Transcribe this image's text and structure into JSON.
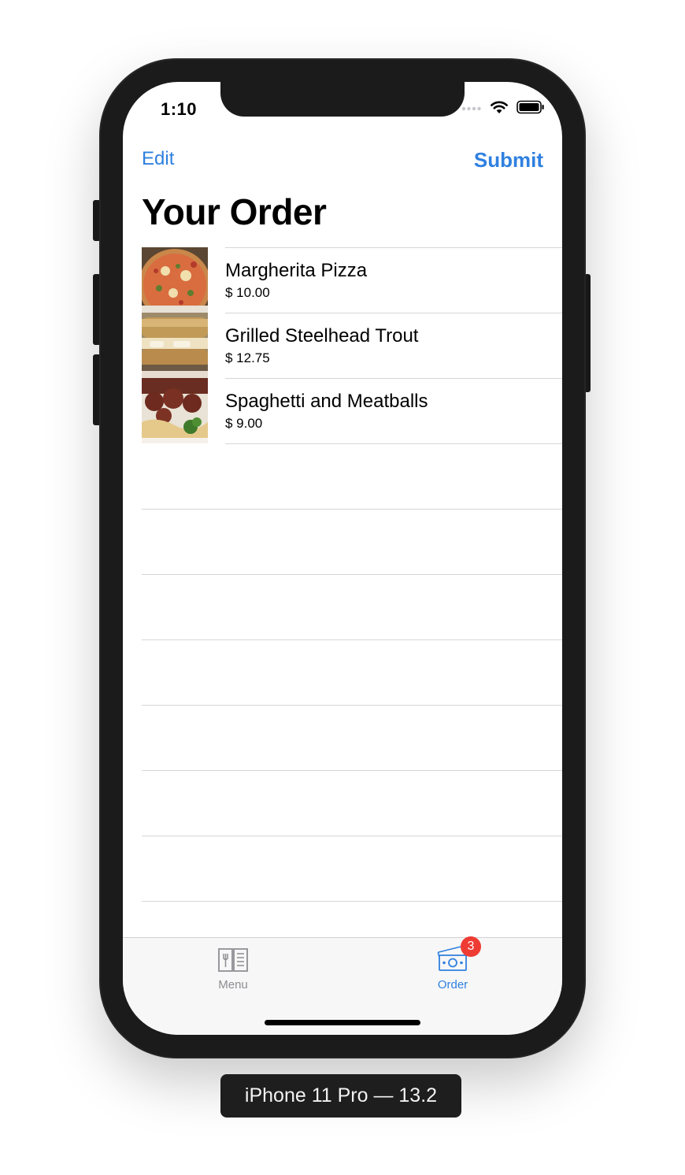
{
  "status_bar": {
    "time": "1:10"
  },
  "nav": {
    "edit_label": "Edit",
    "submit_label": "Submit",
    "title": "Your Order"
  },
  "order_items": [
    {
      "name": "Margherita Pizza",
      "price": "$ 10.00",
      "image": "pizza-photo"
    },
    {
      "name": "Grilled Steelhead Trout",
      "price": "$ 12.75",
      "image": "sandwich-photo"
    },
    {
      "name": "Spaghetti and Meatballs",
      "price": "$ 9.00",
      "image": "spaghetti-photo"
    }
  ],
  "tab_bar": {
    "menu_label": "Menu",
    "order_label": "Order",
    "order_badge": "3",
    "active_tab": "Order"
  },
  "device_label": "iPhone 11 Pro — 13.2",
  "colors": {
    "accent": "#2f80e0",
    "badge": "#ee3b33",
    "inactive_tab": "#8e8e93"
  }
}
